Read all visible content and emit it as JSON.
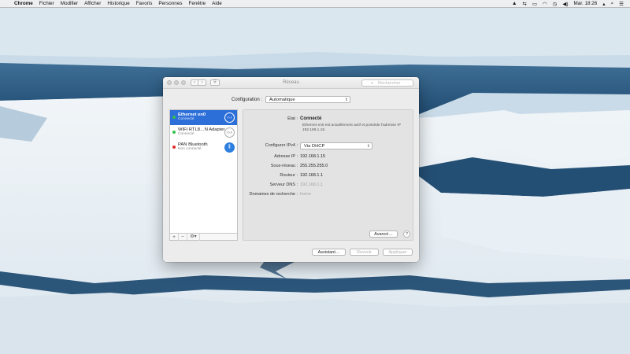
{
  "menubar": {
    "apple_icon": "apple-icon",
    "items": [
      "Chrome",
      "Fichier",
      "Modifier",
      "Afficher",
      "Historique",
      "Favoris",
      "Personnes",
      "Fenêtre",
      "Aide"
    ],
    "clock": "Mar. 18:26"
  },
  "window": {
    "title": "Réseau",
    "search_placeholder": "Rechercher",
    "configuration_label": "Configuration :",
    "configuration_value": "Automatique"
  },
  "services": [
    {
      "name": "Ethernet en0",
      "status": "Connecté",
      "dot_color": "#35c24a",
      "icon": "ethernet-arrows-icon",
      "selected": true
    },
    {
      "name": "WIFI RTL8…N Adapter",
      "status": "Connecté",
      "dot_color": "#35c24a",
      "icon": "ethernet-arrows-icon",
      "selected": false
    },
    {
      "name": "PAN Bluetooth",
      "status": "Non connecté",
      "dot_color": "#e0302b",
      "icon": "bluetooth-icon",
      "selected": false
    }
  ],
  "sidebar_footer": {
    "add": "+",
    "remove": "−",
    "gear": "⚙▾"
  },
  "detail": {
    "status_label": "État :",
    "status_value": "Connecté",
    "status_description": "Ethernet en0 est actuellement actif et possède l'adresse IP 192.168.1.15.",
    "ipv4_label": "Configurer IPv4 :",
    "ipv4_value": "Via DHCP",
    "ip_label": "Adresse IP :",
    "ip_value": "192.168.1.15",
    "subnet_label": "Sous-réseau :",
    "subnet_value": "255.255.255.0",
    "router_label": "Routeur :",
    "router_value": "192.168.1.1",
    "dns_label": "Serveur DNS :",
    "dns_value": "192.168.1.1",
    "search_domains_label": "Domaines de recherche :",
    "search_domains_value": "home",
    "advanced_button": "Avancé…",
    "help_button": "?"
  },
  "footer": {
    "assistant": "Assistant…",
    "revert": "Revenir",
    "apply": "Appliquer"
  }
}
